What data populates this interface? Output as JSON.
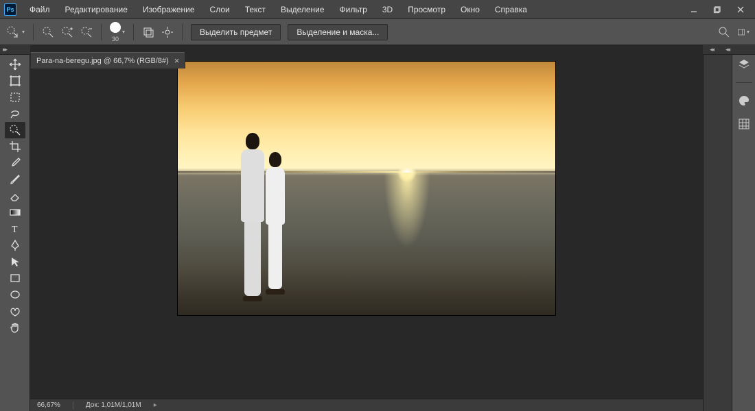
{
  "app": {
    "logo_text": "Ps"
  },
  "menus": {
    "file": "Файл",
    "edit": "Редактирование",
    "image": "Изображение",
    "layers": "Слои",
    "type": "Текст",
    "select": "Выделение",
    "filter": "Фильтр",
    "threeD": "3D",
    "view": "Просмотр",
    "window": "Окно",
    "help": "Справка"
  },
  "options": {
    "brush_size": "30",
    "select_subject": "Выделить предмет",
    "select_and_mask": "Выделение и маска..."
  },
  "document": {
    "tab_title": "Para-na-beregu.jpg @ 66,7% (RGB/8#)"
  },
  "status": {
    "zoom": "66,67%",
    "doc_size_label": "Док:",
    "doc_size_value": "1,01M/1,01M"
  },
  "tool_names": {
    "move": "move-tool",
    "artboard": "artboard-tool",
    "marquee": "marquee-tool",
    "lasso": "lasso-tool",
    "quick_select": "quick-selection-tool",
    "crop": "crop-tool",
    "eyedropper": "eyedropper-tool",
    "brush": "brush-tool",
    "eraser": "eraser-tool",
    "gradient": "gradient-tool",
    "type": "type-tool",
    "pen": "pen-tool",
    "path_select": "path-selection-tool",
    "rect": "rectangle-tool",
    "ellipse": "ellipse-tool",
    "custom_shape": "custom-shape-tool",
    "hand": "hand-tool"
  },
  "dock_panels": {
    "layers": "layers-panel-icon",
    "color": "color-panel-icon",
    "swatches": "swatches-panel-icon"
  }
}
